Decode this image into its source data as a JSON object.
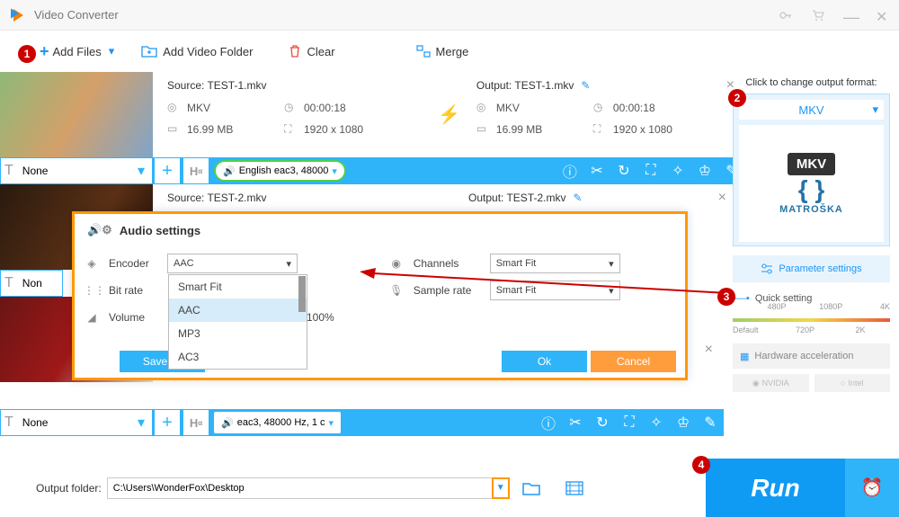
{
  "app": {
    "title": "Video Converter"
  },
  "toolbar": {
    "add_files": "Add Files",
    "add_folder": "Add Video Folder",
    "clear": "Clear",
    "merge": "Merge"
  },
  "files": [
    {
      "source_label": "Source: TEST-1.mkv",
      "output_label": "Output: TEST-1.mkv",
      "container": "MKV",
      "duration": "00:00:18",
      "size": "16.99 MB",
      "resolution": "1920 x 1080",
      "sub_none": "None",
      "audio_pill": "English eac3, 48000"
    },
    {
      "source_label": "Source: TEST-2.mkv",
      "output_label": "Output: TEST-2.mkv",
      "sub_none": "Non"
    },
    {
      "sub_none": "None",
      "audio_pill": "eac3, 48000 Hz, 1 c"
    }
  ],
  "sidebar": {
    "click_label": "Click to change output format:",
    "format": "MKV",
    "logo_text": "MKV",
    "logo_name": "MATROŠKA",
    "param_btn": "Parameter settings",
    "quick_setting": "Quick setting",
    "ticks_top": [
      "480P",
      "1080P",
      "4K"
    ],
    "ticks_bottom": [
      "Default",
      "720P",
      "2K"
    ],
    "hw": "Hardware acceleration",
    "nvidia": "NVIDIA",
    "intel": "Intel"
  },
  "modal": {
    "title": "Audio settings",
    "encoder_label": "Encoder",
    "bitrate_label": "Bit rate",
    "volume_label": "Volume",
    "channels_label": "Channels",
    "sample_label": "Sample rate",
    "volume_value": "100%",
    "encoder_value": "AAC",
    "channels_value": "Smart Fit",
    "sample_value": "Smart Fit",
    "options": [
      "Smart Fit",
      "AAC",
      "MP3",
      "AC3"
    ],
    "save_as": "Save as",
    "ok": "Ok",
    "cancel": "Cancel"
  },
  "bottom": {
    "label": "Output folder:",
    "path": "C:\\Users\\WonderFox\\Desktop",
    "run": "Run"
  },
  "annotations": [
    "1",
    "2",
    "3",
    "4"
  ]
}
